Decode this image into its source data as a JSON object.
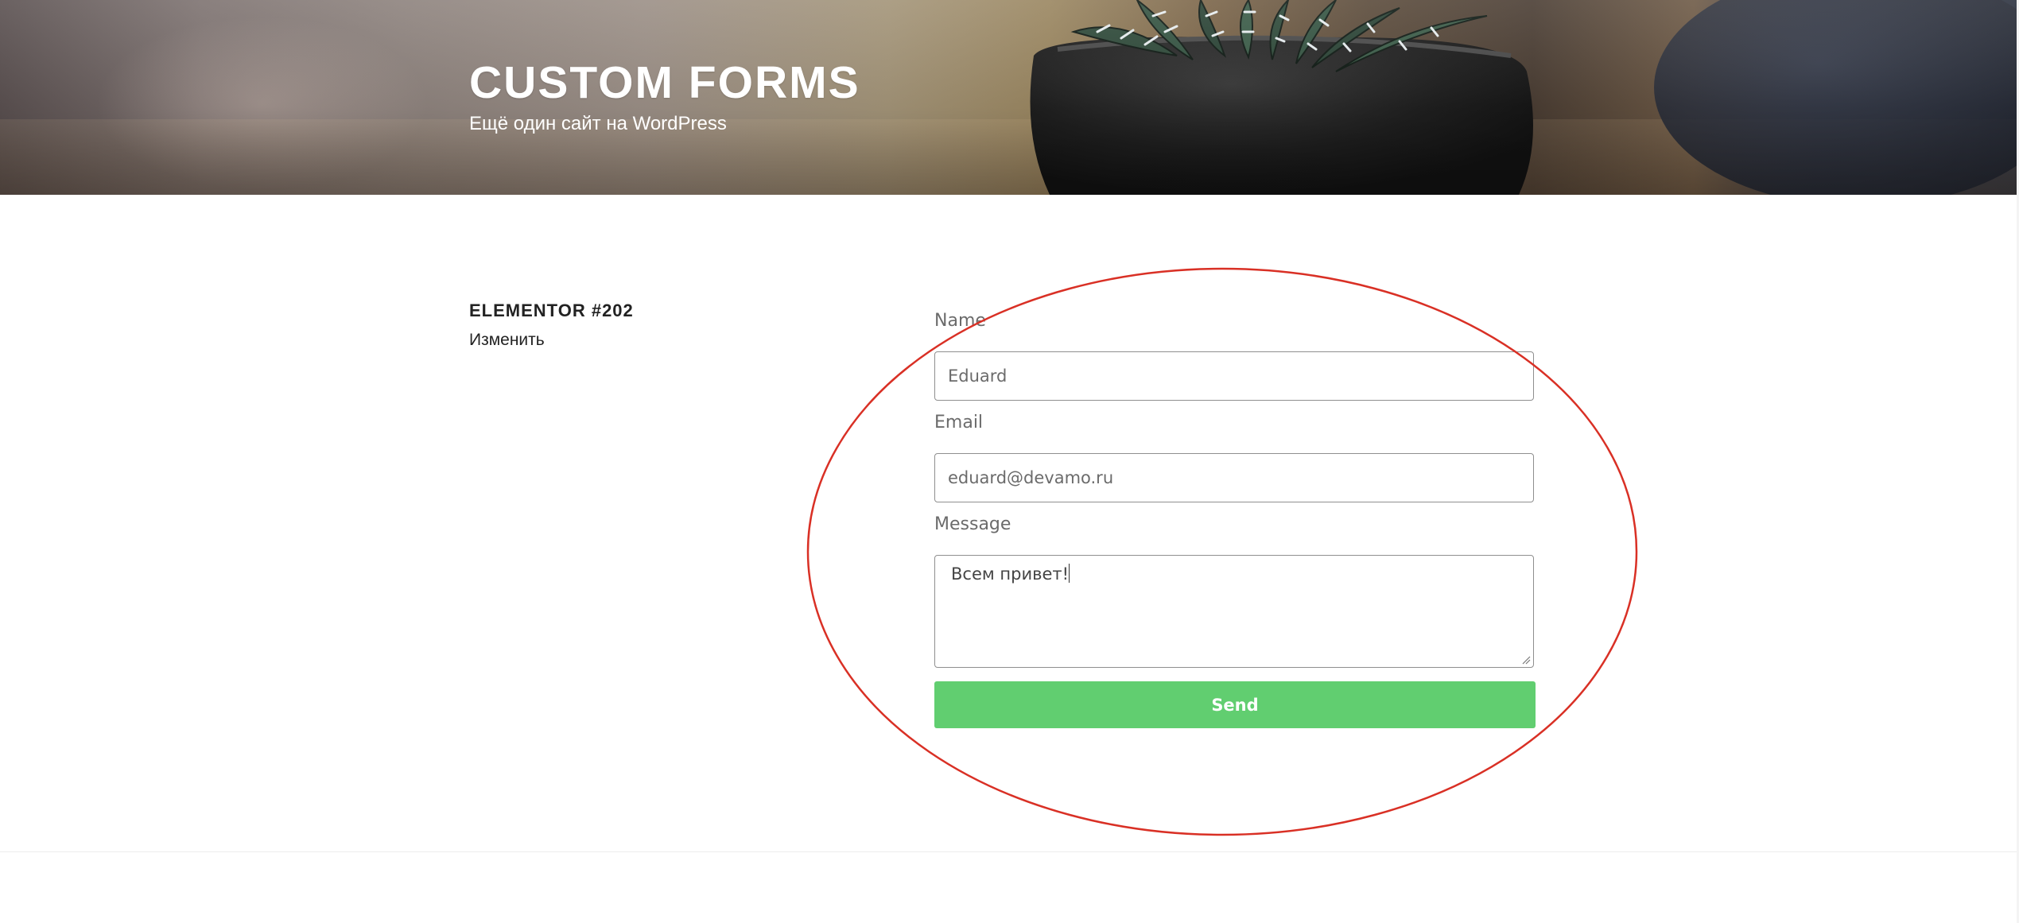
{
  "header": {
    "site_title": "CUSTOM FORMS",
    "tagline": "Ещё один сайт на WordPress"
  },
  "entry": {
    "title": "ELEMENTOR #202",
    "edit_link": "Изменить"
  },
  "form": {
    "name": {
      "label": "Name",
      "value": "Eduard"
    },
    "email": {
      "label": "Email",
      "value": "eduard@devamo.ru"
    },
    "message": {
      "label": "Message",
      "value": "Всем привет!"
    },
    "send_label": "Send"
  },
  "colors": {
    "button": "#61ce70",
    "annotation": "#d93025",
    "input_border": "#8f8f8f"
  },
  "icons": {
    "resize": "resize-grip-icon"
  }
}
